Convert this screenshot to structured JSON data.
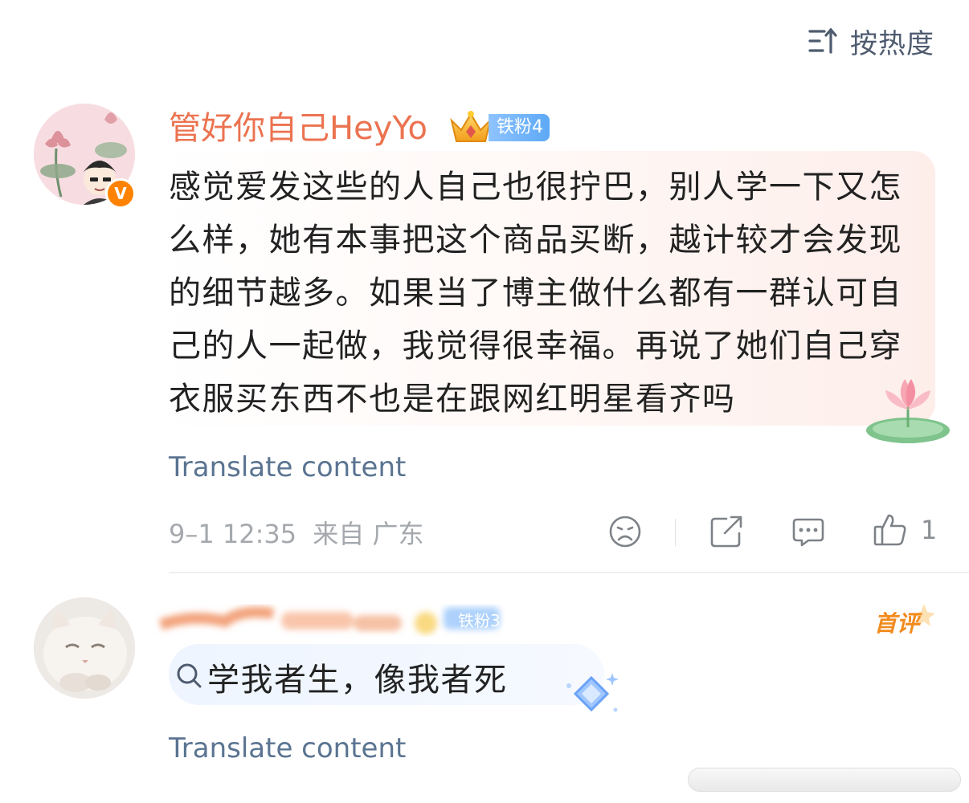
{
  "sort": {
    "label": "按热度",
    "icon": "sort-arrow-icon"
  },
  "comments": [
    {
      "username": "管好你自己HeyYo",
      "fan_badge": "铁粉4",
      "verified_badge": "V",
      "text": "感觉爱发这些的人自己也很拧巴，别人学一下又怎么样，她有本事把这个商品买断，越计较才会发现的细节越多。如果当了博主做什么都有一群认可自己的人一起做，我觉得很幸福。再说了她们自己穿衣服买东西不也是在跟网红明星看齐吗",
      "translate": "Translate content",
      "time": "9–1 12:35",
      "location": "来自 广东",
      "like_count": "1",
      "actions": [
        "dislike-icon",
        "share-icon",
        "comment-icon",
        "like-icon"
      ]
    },
    {
      "fan_badge": "铁粉3",
      "tag": "首评",
      "search_query": "学我者生，像我者死",
      "translate": "Translate content"
    }
  ],
  "colors": {
    "username": "#eb7350",
    "link": "#5a7491",
    "meta": "#a5a9ae",
    "verified": "#ff8200",
    "fan_badge": "#5da9f5"
  }
}
